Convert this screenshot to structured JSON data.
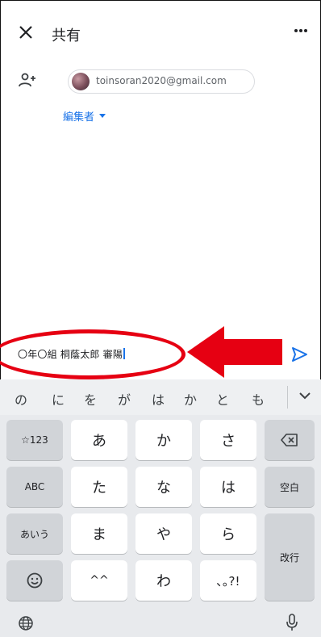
{
  "header": {
    "title": "共有"
  },
  "recipient": {
    "email": "toinsoran2020@gmail.com",
    "role": "編集者"
  },
  "message": {
    "text": "〇年〇組 桐蔭太郎 審陽"
  },
  "keyboard": {
    "suggestions": [
      "の",
      "に",
      "を",
      "が",
      "は",
      "か",
      "と",
      "も"
    ],
    "keys": {
      "sym": "☆123",
      "abc": "ABC",
      "kana_mode": "あいう",
      "a": "あ",
      "ka": "か",
      "sa": "さ",
      "ta": "た",
      "na": "な",
      "ha": "は",
      "ma": "ま",
      "ya": "や",
      "ra": "ら",
      "kigou": "^^",
      "wa": "わ",
      "punct": "､｡?!",
      "space": "空白",
      "enter": "改行"
    }
  },
  "colors": {
    "accent": "#1a73e8",
    "annotation": "#e60012"
  }
}
